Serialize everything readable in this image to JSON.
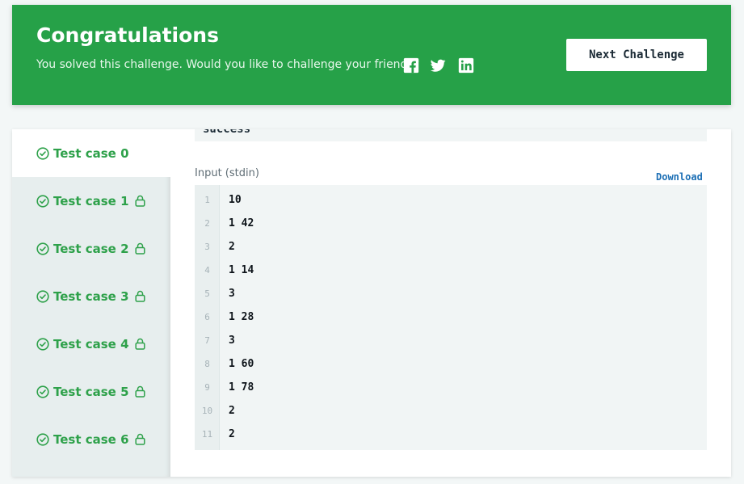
{
  "banner": {
    "title": "Congratulations",
    "message": "You solved this challenge. Would you like to challenge your friends?",
    "next_button": "Next Challenge",
    "background_color": "#26a148",
    "social": [
      "facebook-icon",
      "twitter-icon",
      "linkedin-icon"
    ]
  },
  "previous_output": "success",
  "test_cases": [
    {
      "label": "Test case 0",
      "active": true,
      "locked": false
    },
    {
      "label": "Test case 1",
      "active": false,
      "locked": true
    },
    {
      "label": "Test case 2",
      "active": false,
      "locked": true
    },
    {
      "label": "Test case 3",
      "active": false,
      "locked": true
    },
    {
      "label": "Test case 4",
      "active": false,
      "locked": true
    },
    {
      "label": "Test case 5",
      "active": false,
      "locked": true
    },
    {
      "label": "Test case 6",
      "active": false,
      "locked": true
    }
  ],
  "input": {
    "label": "Input (stdin)",
    "download_label": "Download",
    "lines": [
      "10",
      "1 42",
      "2",
      "1 14",
      "3",
      "1 28",
      "3",
      "1 60",
      "1 78",
      "2",
      "2"
    ],
    "line_numbers": [
      "1",
      "2",
      "3",
      "4",
      "5",
      "6",
      "7",
      "8",
      "9",
      "10",
      "11"
    ]
  },
  "colors": {
    "accent_green": "#2ea14a",
    "link_blue": "#1c6fb5"
  }
}
